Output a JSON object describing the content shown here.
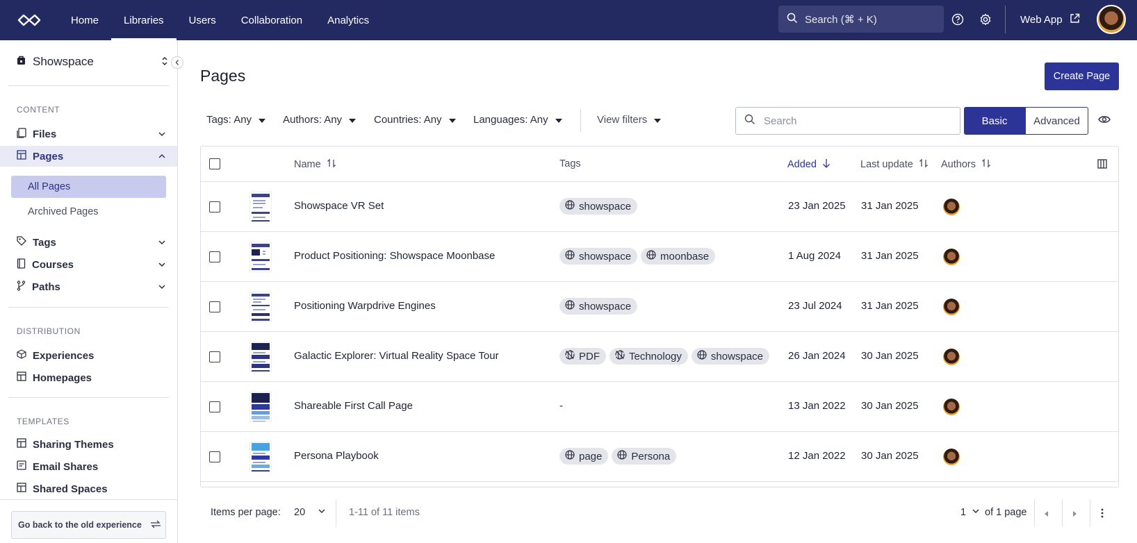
{
  "nav": {
    "items": [
      "Home",
      "Libraries",
      "Users",
      "Collaboration",
      "Analytics"
    ],
    "active": "Libraries",
    "search_label": "Search (⌘ + K)",
    "web_app_label": "Web App"
  },
  "sidebar": {
    "workspace": "Showspace",
    "sections": {
      "content": "CONTENT",
      "distribution": "DISTRIBUTION",
      "templates": "TEMPLATES"
    },
    "items": {
      "files": "Files",
      "pages": "Pages",
      "all_pages": "All Pages",
      "archived_pages": "Archived Pages",
      "tags": "Tags",
      "courses": "Courses",
      "paths": "Paths",
      "experiences": "Experiences",
      "homepages": "Homepages",
      "sharing_themes": "Sharing Themes",
      "email_shares": "Email Shares",
      "shared_spaces": "Shared Spaces"
    },
    "old_experience_label": "Go back to the old experience"
  },
  "main": {
    "title": "Pages",
    "create_label": "Create Page",
    "filters": {
      "tags": "Tags: Any",
      "authors": "Authors: Any",
      "countries": "Countries: Any",
      "languages": "Languages: Any",
      "view": "View filters"
    },
    "search_placeholder": "Search",
    "mode_basic": "Basic",
    "mode_advanced": "Advanced",
    "active_mode": "Basic"
  },
  "table": {
    "columns": {
      "name": "Name",
      "tags": "Tags",
      "added": "Added",
      "last_update": "Last update",
      "authors": "Authors"
    },
    "sorted_column": "Added",
    "rows": [
      {
        "name": "Showspace VR Set",
        "tags": [
          {
            "label": "showspace",
            "icon": "globe-icon"
          }
        ],
        "added": "23 Jan 2025",
        "updated": "31 Jan 2025"
      },
      {
        "name": "Product Positioning: Showspace Moonbase",
        "tags": [
          {
            "label": "showspace",
            "icon": "globe-icon"
          },
          {
            "label": "moonbase",
            "icon": "globe-icon"
          }
        ],
        "added": "1 Aug 2024",
        "updated": "31 Jan 2025"
      },
      {
        "name": "Positioning Warpdrive Engines",
        "tags": [
          {
            "label": "showspace",
            "icon": "globe-icon"
          }
        ],
        "added": "23 Jul 2024",
        "updated": "31 Jan 2025"
      },
      {
        "name": "Galactic Explorer: Virtual Reality Space Tour",
        "tags": [
          {
            "label": "PDF",
            "icon": "globe-off-icon"
          },
          {
            "label": "Technology",
            "icon": "globe-off-icon"
          },
          {
            "label": "showspace",
            "icon": "globe-icon"
          }
        ],
        "added": "26 Jan 2024",
        "updated": "30 Jan 2025"
      },
      {
        "name": "Shareable First Call Page",
        "tags": [],
        "no_tags": "-",
        "added": "13 Jan 2022",
        "updated": "30 Jan 2025"
      },
      {
        "name": "Persona Playbook",
        "tags": [
          {
            "label": "page",
            "icon": "globe-icon"
          },
          {
            "label": "Persona",
            "icon": "globe-icon"
          }
        ],
        "added": "12 Jan 2022",
        "updated": "30 Jan 2025"
      }
    ]
  },
  "pagination": {
    "items_per_page_label": "Items per page:",
    "items_per_page": "20",
    "range": "1-11 of 11 items",
    "current_page": "1",
    "of_pages": "of 1 page"
  },
  "colors": {
    "nav_bg": "#232a62",
    "accent": "#2d3497",
    "active_bg": "#c9cbee"
  }
}
